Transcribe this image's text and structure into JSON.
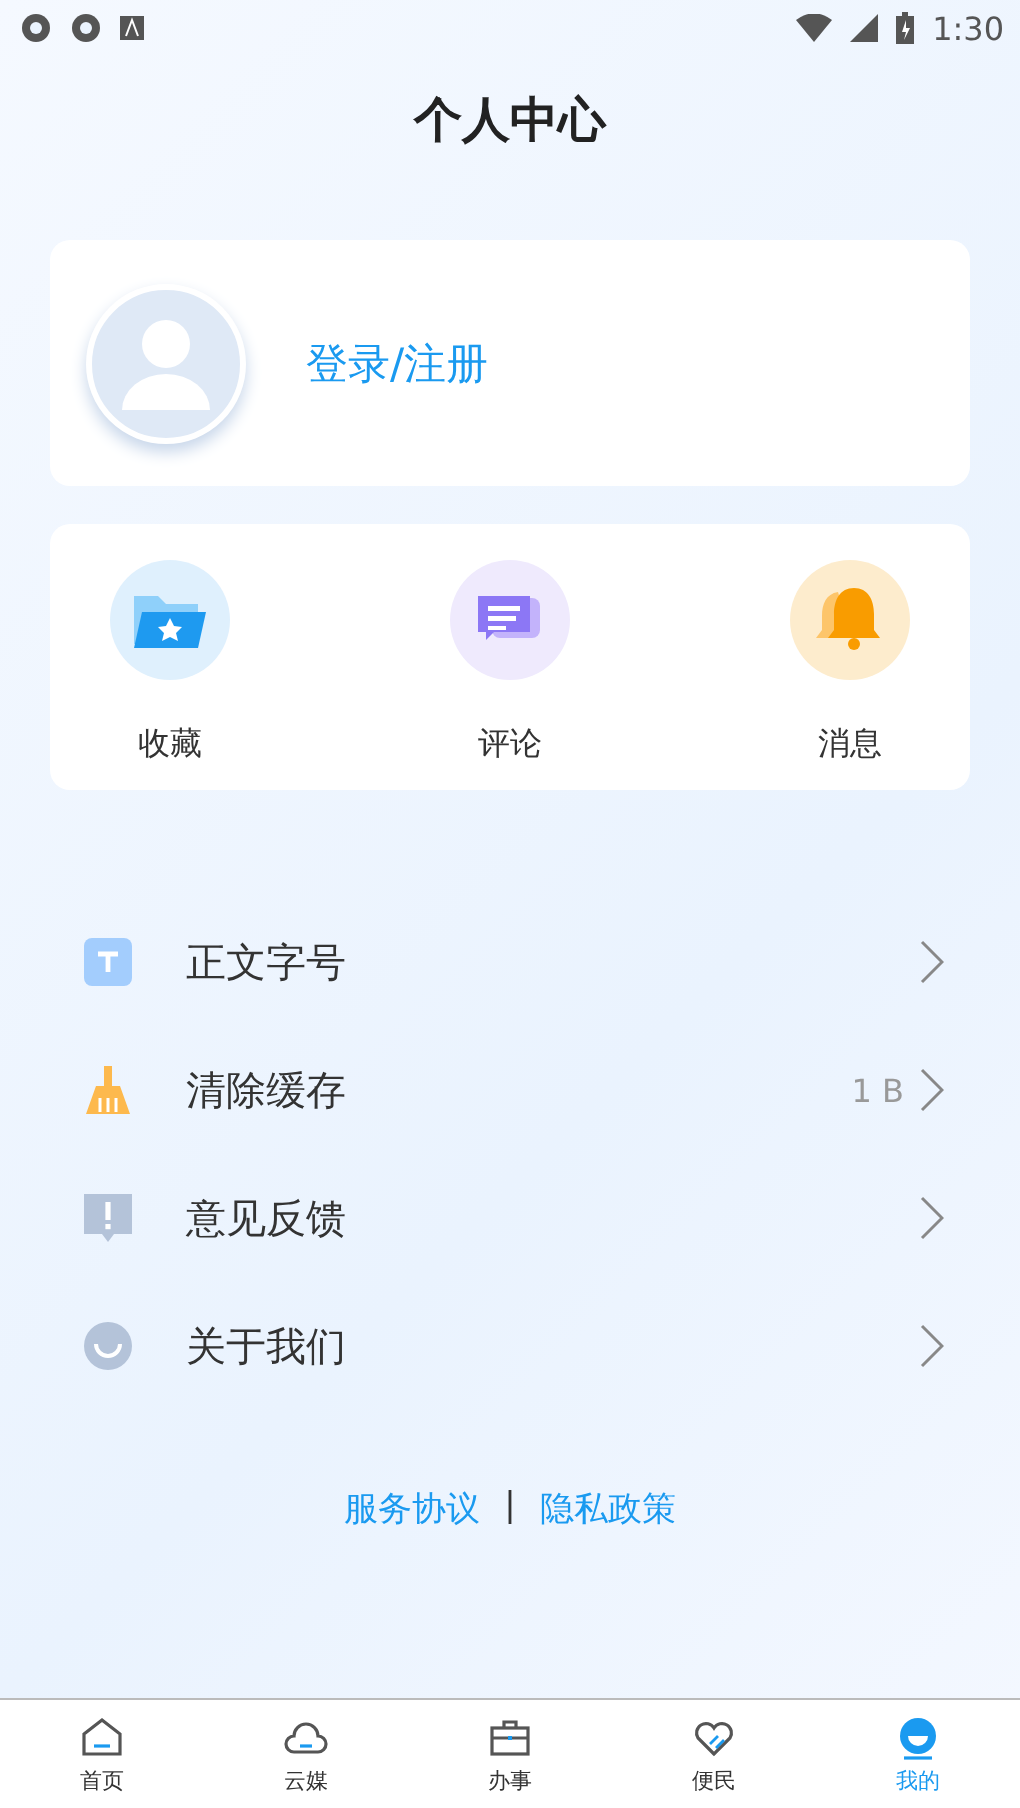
{
  "status_bar": {
    "time": "1:30"
  },
  "title": "个人中心",
  "profile": {
    "login_label": "登录/注册"
  },
  "shortcuts": [
    {
      "kind": "favorites",
      "label": "收藏"
    },
    {
      "kind": "comments",
      "label": "评论"
    },
    {
      "kind": "messages",
      "label": "消息"
    }
  ],
  "menu": [
    {
      "kind": "font",
      "label": "正文字号"
    },
    {
      "kind": "cache",
      "label": "清除缓存",
      "value": "1 B"
    },
    {
      "kind": "feedback",
      "label": "意见反馈"
    },
    {
      "kind": "about",
      "label": "关于我们"
    }
  ],
  "links": [
    "服务协议",
    "|",
    "隐私政策"
  ],
  "tabs": [
    {
      "kind": "home",
      "label": "首页",
      "selected": false
    },
    {
      "kind": "cloud",
      "label": "云媒",
      "selected": false
    },
    {
      "kind": "work",
      "label": "办事",
      "selected": false
    },
    {
      "kind": "service",
      "label": "便民",
      "selected": false
    },
    {
      "kind": "me",
      "label": "我的",
      "selected": true
    }
  ]
}
